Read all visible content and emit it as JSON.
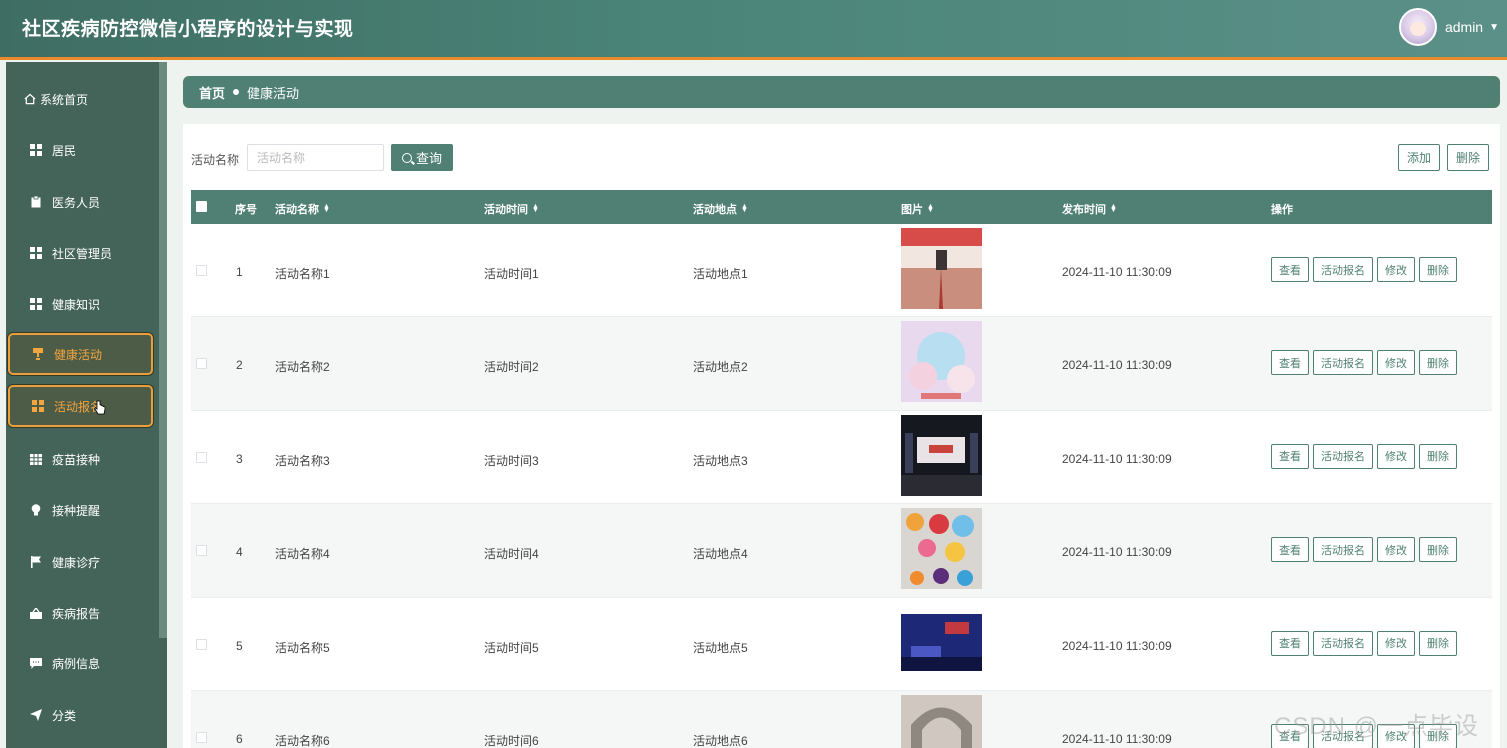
{
  "app": {
    "title": "社区疾病防控微信小程序的设计与实现",
    "username": "admin"
  },
  "sidebar": {
    "items": [
      {
        "label": "系统首页",
        "icon": "home-icon"
      },
      {
        "label": "居民",
        "icon": "grid-icon"
      },
      {
        "label": "医务人员",
        "icon": "clipboard-icon"
      },
      {
        "label": "社区管理员",
        "icon": "grid-icon"
      },
      {
        "label": "健康知识",
        "icon": "grid-icon"
      },
      {
        "label": "健康活动",
        "icon": "trophy-icon",
        "active": true
      },
      {
        "label": "活动报名",
        "icon": "grid-icon",
        "active": true
      },
      {
        "label": "疫苗接种",
        "icon": "table-icon"
      },
      {
        "label": "接种提醒",
        "icon": "bulb-icon"
      },
      {
        "label": "健康诊疗",
        "icon": "flag-icon"
      },
      {
        "label": "疾病报告",
        "icon": "box-icon"
      },
      {
        "label": "病例信息",
        "icon": "chat-icon"
      },
      {
        "label": "分类",
        "icon": "send-icon"
      }
    ]
  },
  "breadcrumb": {
    "home": "首页",
    "current": "健康活动"
  },
  "search": {
    "label": "活动名称",
    "placeholder": "活动名称",
    "button": "查询"
  },
  "toolbar": {
    "add": "添加",
    "delete": "删除"
  },
  "table": {
    "columns": [
      "序号",
      "活动名称",
      "活动时间",
      "活动地点",
      "图片",
      "发布时间",
      "操作"
    ],
    "rows": [
      {
        "index": "1",
        "name": "活动名称1",
        "time": "活动时间1",
        "place": "活动地点1",
        "published": "2024-11-10 11:30:09"
      },
      {
        "index": "2",
        "name": "活动名称2",
        "time": "活动时间2",
        "place": "活动地点2",
        "published": "2024-11-10 11:30:09"
      },
      {
        "index": "3",
        "name": "活动名称3",
        "time": "活动时间3",
        "place": "活动地点3",
        "published": "2024-11-10 11:30:09"
      },
      {
        "index": "4",
        "name": "活动名称4",
        "time": "活动时间4",
        "place": "活动地点4",
        "published": "2024-11-10 11:30:09"
      },
      {
        "index": "5",
        "name": "活动名称5",
        "time": "活动时间5",
        "place": "活动地点5",
        "published": "2024-11-10 11:30:09"
      },
      {
        "index": "6",
        "name": "活动名称6",
        "time": "活动时间6",
        "place": "活动地点6",
        "published": "2024-11-10 11:30:09"
      }
    ],
    "actions": [
      "查看",
      "活动报名",
      "修改",
      "删除"
    ]
  },
  "watermark": "CSDN @一点毕设",
  "colors": {
    "accent": "#4f8073",
    "sidebar": "#446459",
    "highlight": "#e9a03a"
  }
}
